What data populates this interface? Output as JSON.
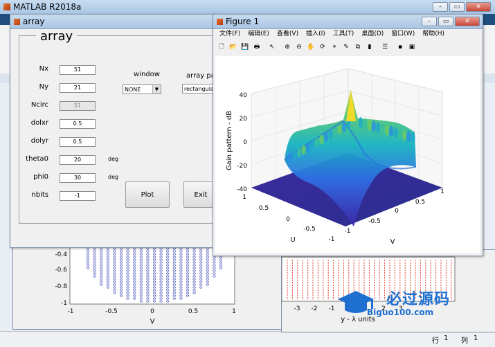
{
  "main_window": {
    "title": "MATLAB R2018a"
  },
  "array_window": {
    "title": "array",
    "panel_title": "array",
    "fields": [
      {
        "label": "Nx",
        "value": "51",
        "unit": "",
        "enabled": true
      },
      {
        "label": "Ny",
        "value": "21",
        "unit": "",
        "enabled": true
      },
      {
        "label": "Ncirc",
        "value": "51",
        "unit": "",
        "enabled": false
      },
      {
        "label": "dolxr",
        "value": "0.5",
        "unit": "",
        "enabled": true
      },
      {
        "label": "dolyr",
        "value": "0.5",
        "unit": "",
        "enabled": true
      },
      {
        "label": "theta0",
        "value": "20",
        "unit": "deg",
        "enabled": true
      },
      {
        "label": "phi0",
        "value": "30",
        "unit": "deg",
        "enabled": true
      },
      {
        "label": "nbits",
        "value": "-1",
        "unit": "",
        "enabled": true
      }
    ],
    "window_label": "window",
    "window_value": "NONE",
    "array_pattern_label": "array patt",
    "array_pattern_value": "rectangular",
    "plot_label": "Plot",
    "exit_label": "Exit"
  },
  "figure_window": {
    "title": "Figure 1",
    "menu": [
      "文件(F)",
      "编辑(E)",
      "查看(V)",
      "插入(I)",
      "工具(T)",
      "桌面(D)",
      "窗口(W)",
      "帮助(H)"
    ],
    "toolbar_icons": [
      "new-icon",
      "open-icon",
      "save-icon",
      "print-icon",
      "pointer-icon",
      "zoom-in-icon",
      "zoom-out-icon",
      "pan-icon",
      "rotate-icon",
      "datacursor-icon",
      "brush-icon",
      "link-icon",
      "colorbar-icon",
      "legend-icon",
      "hide-plot-icon",
      "show-plot-icon"
    ],
    "zlabel": "Gain pattern - dB",
    "z_ticks": [
      "40",
      "20",
      "0",
      "-20",
      "-40"
    ],
    "u_ticks": [
      "1",
      "0.5",
      "0",
      "-0.5",
      "-1"
    ],
    "v_ticks": [
      "-1",
      "-0.5",
      "0",
      "0.5",
      "1"
    ],
    "u_label": "U",
    "v_label": "V"
  },
  "back_left_plot": {
    "y_ticks": [
      "-0.4",
      "-0.6",
      "-0.8",
      "-1"
    ],
    "x_ticks": [
      "-1",
      "-0.5",
      "0",
      "0.5",
      "1"
    ],
    "x_label": "V"
  },
  "back_right_plot": {
    "x_ticks": [
      "-3",
      "-2",
      "-1",
      "0",
      "1",
      "2",
      "3"
    ],
    "x_label": "y - λ units"
  },
  "watermark": {
    "text": "必过源码",
    "sub": "Biguo100.com"
  },
  "status": {
    "row_label": "行",
    "row": "1",
    "col_label": "列",
    "col": "1"
  }
}
